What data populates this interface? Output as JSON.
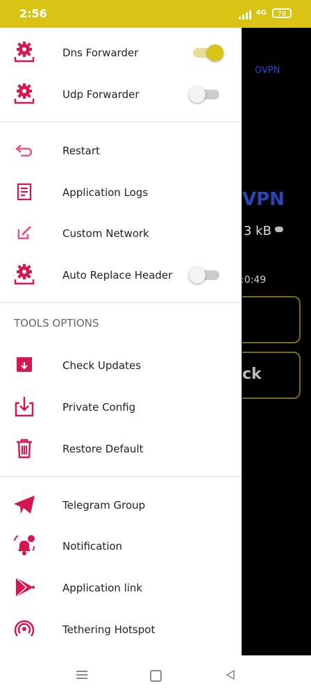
{
  "status_bar": {
    "time": "2:56",
    "network": "4G",
    "battery": "78"
  },
  "background": {
    "ovpn_label": "OVPN",
    "vpn_title": "VPN",
    "traffic": "3 kB",
    "timer": ":0:49",
    "button_text": "ck"
  },
  "drawer": {
    "dns_forwarder": {
      "label": "Dns Forwarder",
      "enabled": true
    },
    "udp_forwarder": {
      "label": "Udp Forwarder",
      "enabled": false
    },
    "restart": "Restart",
    "application_logs": "Application Logs",
    "custom_network": "Custom Network",
    "auto_replace_header": {
      "label": "Auto Replace Header",
      "enabled": false
    },
    "tools_section_title": "TOOLS OPTIONS",
    "check_updates": "Check Updates",
    "private_config": "Private Config",
    "restore_default": "Restore Default",
    "telegram_group": "Telegram Group",
    "notification": "Notification",
    "application_link": "Application link",
    "tethering_hotspot": "Tethering Hotspot"
  },
  "colors": {
    "accent_pink": "#d6164f",
    "toggle_on": "#d9c416",
    "status_bar_bg": "#d9c416"
  },
  "icons": [
    "gear-download-icon",
    "back-arrow-icon",
    "logs-icon",
    "edit-icon",
    "check-updates-icon",
    "download-icon",
    "trash-icon",
    "telegram-icon",
    "bell-icon",
    "play-store-icon",
    "hotspot-icon"
  ]
}
